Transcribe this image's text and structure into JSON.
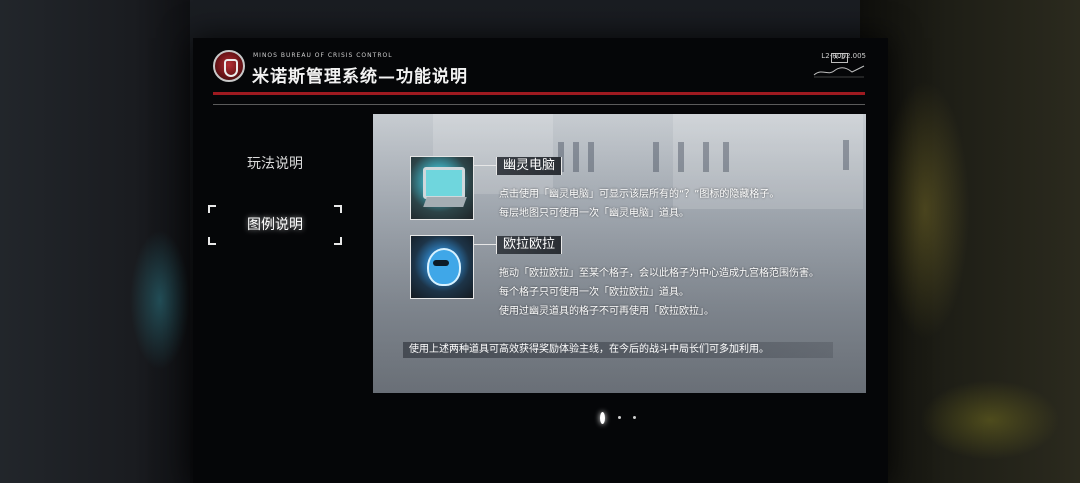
{
  "header": {
    "org": "MINOS BUREAU OF CRISIS CONTROL",
    "title": "米诺斯管理系统—功能说明",
    "code_tag": "A-D",
    "code": "L2-R002.005"
  },
  "menu": {
    "items": [
      {
        "label": "玩法说明",
        "selected": false
      },
      {
        "label": "图例说明",
        "selected": true
      }
    ]
  },
  "content": {
    "items": [
      {
        "icon": "ghost-computer-icon",
        "name": "幽灵电脑",
        "lines": [
          "点击使用「幽灵电脑」可显示该层所有的“？”图标的隐藏格子。",
          "每层地图只可使用一次「幽灵电脑」道具。"
        ]
      },
      {
        "icon": "ora-ora-icon",
        "name": "欧拉欧拉",
        "lines": [
          "拖动「欧拉欧拉」至某个格子，会以此格子为中心造成九宫格范围伤害。",
          "每个格子只可使用一次「欧拉欧拉」道具。",
          "使用过幽灵道具的格子不可再使用「欧拉欧拉」。"
        ]
      }
    ],
    "footer": "使用上述两种道具可高效获得奖励体验主线，在今后的战斗中局长们可多加利用。"
  },
  "pager": {
    "total": 3,
    "current": 1
  },
  "colors": {
    "accent_red": "#9e1a20",
    "panel_bg": "#050608"
  }
}
